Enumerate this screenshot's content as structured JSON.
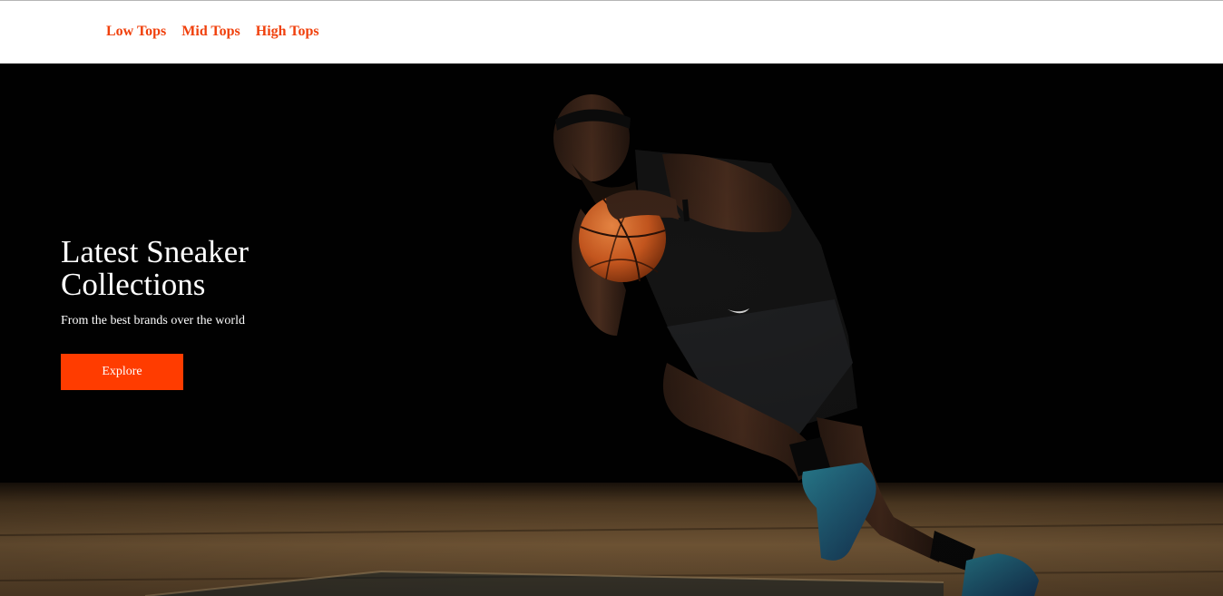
{
  "nav": {
    "items": [
      {
        "label": "Low Tops"
      },
      {
        "label": "Mid Tops"
      },
      {
        "label": "High Tops"
      }
    ],
    "link_color": "#f0400c"
  },
  "hero": {
    "title": "Latest Sneaker Collections",
    "subtitle": "From the best brands over the world",
    "cta_label": "Explore",
    "cta_color": "#ff3c00",
    "image": "basketball-player-photo"
  }
}
